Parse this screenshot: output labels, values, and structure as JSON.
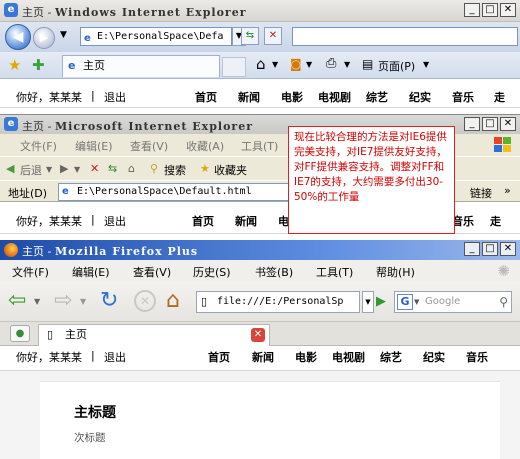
{
  "ie7": {
    "window_title": "主页",
    "app_name": "Windows Internet Explorer",
    "address": "E:\\PersonalSpace\\Defa",
    "tab_label": "主页",
    "page_menu_label": "页面(P)"
  },
  "ie6": {
    "window_title": "主页",
    "app_name": "Microsoft Internet Explorer",
    "menu": [
      "文件(F)",
      "编辑(E)",
      "查看(V)",
      "收藏(A)",
      "工具(T)"
    ],
    "back_label": "后退",
    "search_label": "搜索",
    "favorites_label": "收藏夹",
    "address_label": "地址(D)",
    "address": "E:\\PersonalSpace\\Default.html",
    "links_label": "链接"
  },
  "firefox": {
    "window_title": "主页",
    "app_name": "Mozilla Firefox Plus",
    "menu": [
      "文件(F)",
      "编辑(E)",
      "查看(V)",
      "历史(S)",
      "书签(B)",
      "工具(T)",
      "帮助(H)"
    ],
    "address": "file:///E:/PersonalSp",
    "search_placeholder": "Google",
    "tab_label": "主页"
  },
  "site": {
    "greeting": "你好，某某某",
    "divider": "|",
    "logout": "退出",
    "nav": [
      "首页",
      "新闻",
      "电影",
      "电视剧",
      "综艺",
      "纪实",
      "音乐",
      "走"
    ],
    "heading": "主标题",
    "subheading": "次标题"
  },
  "annotation": {
    "text": "现在比较合理的方法是对IE6提供完美支持，对IE7提供友好支持，对FF提供兼容支持。调整对FF和IE7的支持，大约需要多付出30-50%的工作量"
  },
  "colors": {
    "annotation_red": "#d40000",
    "firefox_title_blue": "#1c4ca8",
    "ie_link_blue": "#2a62c6"
  }
}
